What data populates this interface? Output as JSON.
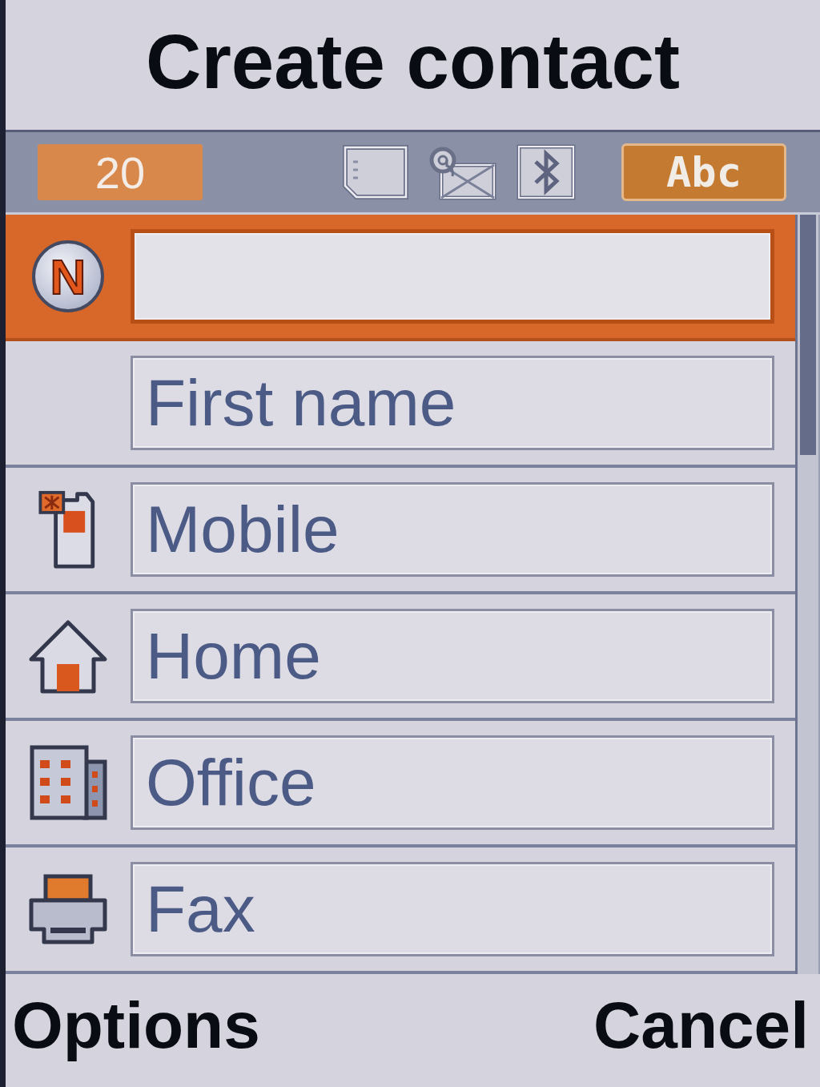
{
  "screen": {
    "title": "Create contact"
  },
  "status_bar": {
    "counter": "20",
    "input_mode": "Abc"
  },
  "fields": [
    {
      "kind": "name",
      "badge": "N",
      "selected": true
    },
    {
      "kind": "name",
      "placeholder": "First name",
      "selected": false
    },
    {
      "kind": "mobile",
      "placeholder": "Mobile",
      "selected": false
    },
    {
      "kind": "home",
      "placeholder": "Home",
      "selected": false
    },
    {
      "kind": "office",
      "placeholder": "Office",
      "selected": false
    },
    {
      "kind": "fax",
      "placeholder": "Fax",
      "selected": false
    }
  ],
  "softkeys": {
    "left": "Options",
    "right": "Cancel"
  }
}
